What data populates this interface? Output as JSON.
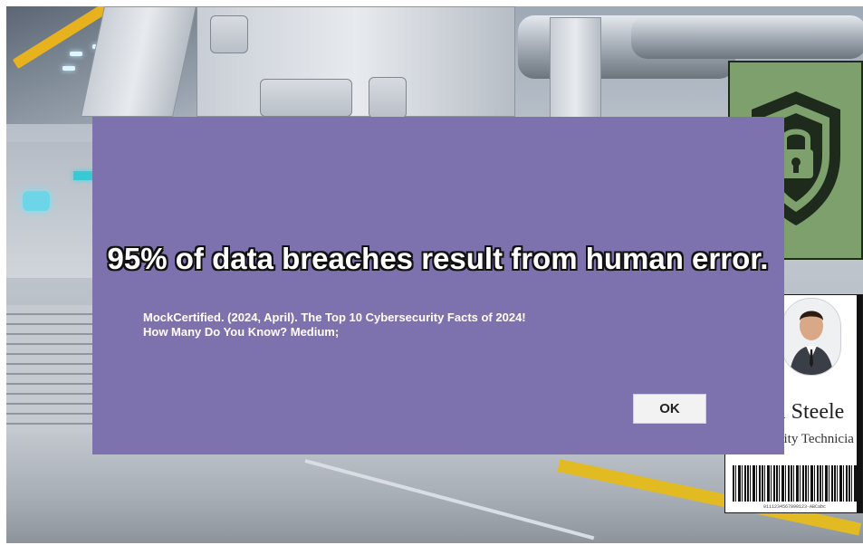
{
  "dialog": {
    "headline": "95% of data breaches result from human error.",
    "source_line1": "MockCertified. (2024, April). The Top 10 Cybersecurity Facts of 2024!",
    "source_line2": "How Many Do You Know? Medium;",
    "ok_label": "OK",
    "background_color": "#7e72ae"
  },
  "poster": {
    "icon": "shield-lock-icon",
    "background_color": "#7da06d"
  },
  "badge": {
    "name_visible": "an Steele",
    "role_visible": "urity Technicia",
    "barcode_text": "0111234567890123-ABCabc"
  }
}
